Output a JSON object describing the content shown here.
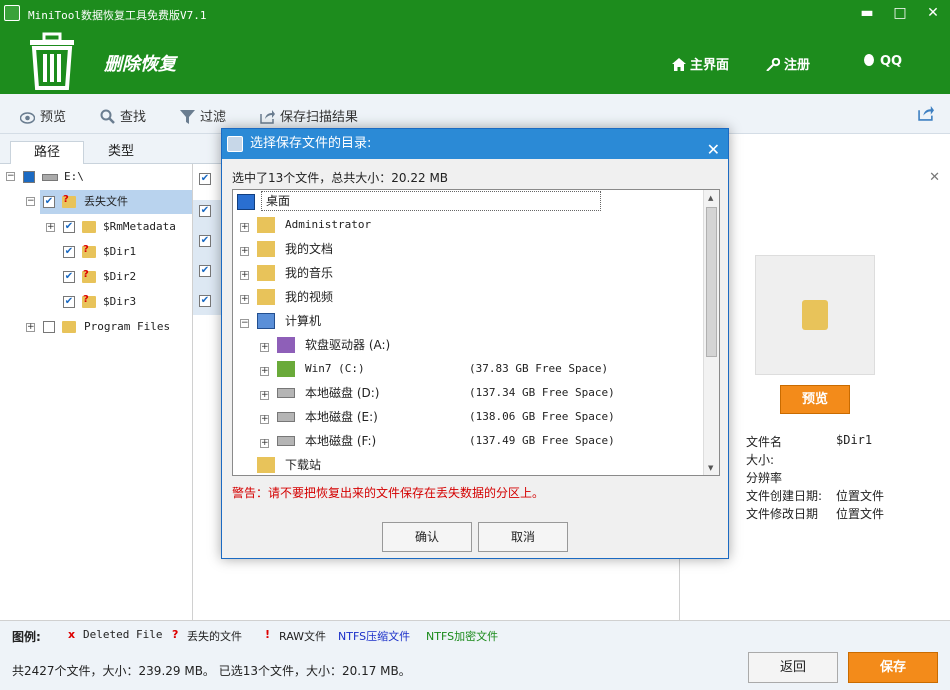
{
  "app": {
    "title": "MiniTool数据恢复工具免费版V7.1",
    "mode_title": "删除恢复",
    "nav_home": "主界面",
    "nav_register": "注册",
    "nav_qq": "QQ",
    "win_min": "▬",
    "win_max": "□",
    "win_close": "✕"
  },
  "toolbar": {
    "preview": "预览",
    "find": "查找",
    "filter": "过滤",
    "save_scan": "保存扫描结果"
  },
  "tabs": {
    "path": "路径",
    "type": "类型"
  },
  "tree": {
    "root": "E:\\",
    "lost": "丢失文件",
    "items": [
      "$RmMetadata",
      "$Dir1",
      "$Dir2",
      "$Dir3"
    ],
    "program_files": "Program Files"
  },
  "right": {
    "preview_btn": "预览",
    "props": [
      {
        "label": "文件名",
        "value": "$Dir1"
      },
      {
        "label": "大小:",
        "value": ""
      },
      {
        "label": "分辨率",
        "value": ""
      },
      {
        "label": "文件创建日期:",
        "value": "位置文件"
      },
      {
        "label": "文件修改日期",
        "value": "位置文件"
      }
    ]
  },
  "legend": {
    "title": "图例:",
    "deleted": "Deleted File",
    "lost": "丢失的文件",
    "raw": "RAW文件",
    "ntfs_compressed": "NTFS压缩文件",
    "ntfs_encrypted": "NTFS加密文件"
  },
  "status": {
    "text": "共2427个文件，大小：239.29 MB。 已选13个文件，大小：20.17 MB。",
    "back": "返回",
    "save": "保存"
  },
  "dialog": {
    "title": "选择保存文件的目录:",
    "summary": "选中了13个文件，总共大小：20.22 MB",
    "desktop": "桌面",
    "admin": "Administrator",
    "docs": "我的文档",
    "music": "我的音乐",
    "video": "我的视频",
    "computer": "计算机",
    "drives": [
      {
        "name": "软盘驱动器 (A:)",
        "free": ""
      },
      {
        "name": "Win7 (C:)",
        "free": "(37.83 GB Free Space)"
      },
      {
        "name": "本地磁盘 (D:)",
        "free": "(137.34 GB Free Space)"
      },
      {
        "name": "本地磁盘 (E:)",
        "free": "(138.06 GB Free Space)"
      },
      {
        "name": "本地磁盘 (F:)",
        "free": "(137.49 GB Free Space)"
      }
    ],
    "downloads": "下载站",
    "warning": "警告：请不要把恢复出来的文件保存在丢失数据的分区上。",
    "ok": "确认",
    "cancel": "取消"
  },
  "colors": {
    "brand_green": "#1d8c1d",
    "accent_orange": "#f38b1a",
    "dialog_blue": "#2b8ad6",
    "warning_red": "#d40000"
  }
}
